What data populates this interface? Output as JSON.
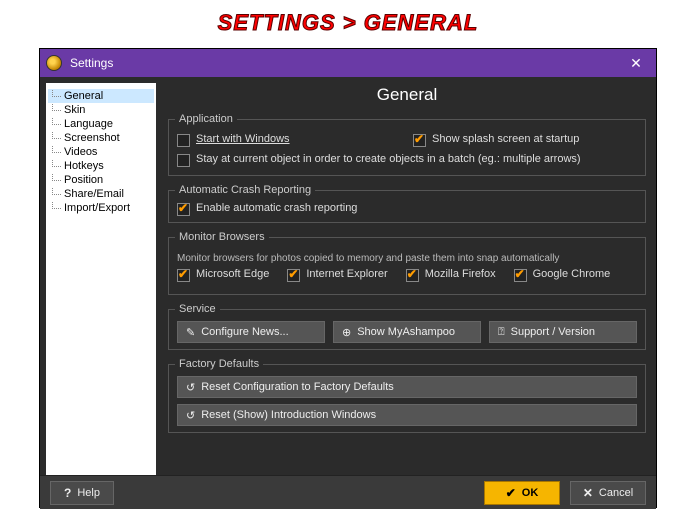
{
  "banner": "SETTINGS > GENERAL",
  "window": {
    "title": "Settings"
  },
  "sidebar": {
    "items": [
      "General",
      "Skin",
      "Language",
      "Screenshot",
      "Videos",
      "Hotkeys",
      "Position",
      "Share/Email",
      "Import/Export"
    ],
    "selected": 0
  },
  "page": {
    "title": "General"
  },
  "groups": {
    "application": {
      "legend": "Application",
      "start_with_windows": {
        "label": "Start with Windows",
        "checked": false
      },
      "show_splash": {
        "label": "Show splash screen at startup",
        "checked": true
      },
      "stay_at_object": {
        "label": "Stay at current object in order to create objects in a batch (eg.: multiple arrows)",
        "checked": false
      }
    },
    "crash": {
      "legend": "Automatic Crash Reporting",
      "enable": {
        "label": "Enable automatic crash reporting",
        "checked": true
      }
    },
    "monitor": {
      "legend": "Monitor Browsers",
      "hint": "Monitor browsers for photos copied to memory and paste them into snap automatically",
      "edge": {
        "label": "Microsoft Edge",
        "checked": true
      },
      "ie": {
        "label": "Internet Explorer",
        "checked": true
      },
      "firefox": {
        "label": "Mozilla Firefox",
        "checked": true
      },
      "chrome": {
        "label": "Google Chrome",
        "checked": true
      }
    },
    "service": {
      "legend": "Service",
      "configure_news": "Configure News...",
      "show_myashampoo": "Show MyAshampoo",
      "support_version": "Support / Version"
    },
    "factory": {
      "legend": "Factory Defaults",
      "reset_config": "Reset Configuration to Factory Defaults",
      "reset_intro": "Reset (Show) Introduction Windows"
    }
  },
  "footer": {
    "help": "Help",
    "ok": "OK",
    "cancel": "Cancel"
  }
}
